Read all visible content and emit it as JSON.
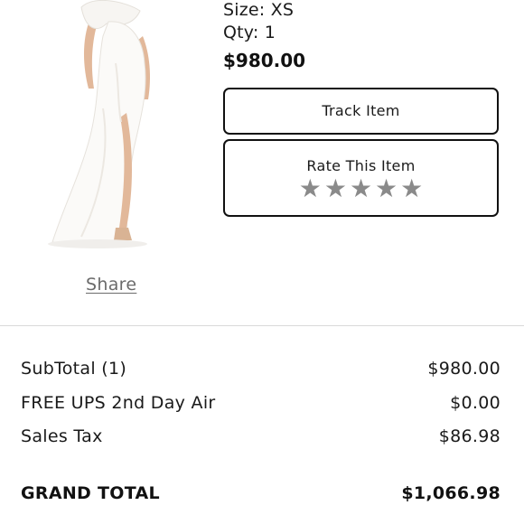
{
  "item": {
    "size": "Size: XS",
    "qty": "Qty: 1",
    "price": "$980.00"
  },
  "actions": {
    "track_label": "Track Item",
    "rate_label": "Rate This Item",
    "star_count": 5,
    "rating": 0
  },
  "share_label": "Share",
  "summary": {
    "subtotal": {
      "label": "SubTotal (1)",
      "value": "$980.00"
    },
    "shipping": {
      "label": "FREE UPS 2nd Day Air",
      "value": "$0.00"
    },
    "tax": {
      "label": "Sales Tax",
      "value": "$86.98"
    },
    "grand_total": {
      "label": "GRAND TOTAL",
      "value": "$1,066.98"
    }
  },
  "colors": {
    "text": "#1a1a1a",
    "star": "#8a8a8a",
    "link": "#6b6b6b",
    "divider": "#d9d9d9"
  }
}
